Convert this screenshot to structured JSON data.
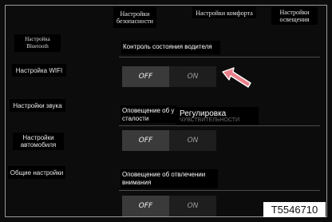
{
  "header": {
    "tabs": [
      {
        "label": "Настройки безопасности"
      },
      {
        "label": "Настройки комфорта"
      },
      {
        "label": "Настройки освещения"
      }
    ]
  },
  "sidebar": {
    "items": [
      {
        "label": "Настройка Bluetooth"
      },
      {
        "label": "Настройка WIFI"
      },
      {
        "label": "Настройки звука"
      },
      {
        "label": "Настройки автомобиля"
      },
      {
        "label": "Общие настройки"
      }
    ]
  },
  "settings": [
    {
      "label": "Контроль состояния водителя",
      "off_label": "OFF",
      "on_label": "ON",
      "state": "OFF"
    },
    {
      "label": "Оповещение об у сталости",
      "off_label": "OFF",
      "on_label": "ON",
      "state": "OFF"
    },
    {
      "label": "Оповещение об отвлечении внимания",
      "off_label": "OFF",
      "on_label": "ON",
      "state": "OFF"
    }
  ],
  "overlay": {
    "title": "Регулировка",
    "subtitle": "ЧУВСТВИТЕЛЬНОСТИ"
  },
  "annotation": {
    "arrow": "pink-arrow-icon",
    "arrow_color": "#e8808a"
  },
  "image_code": "T5546710"
}
